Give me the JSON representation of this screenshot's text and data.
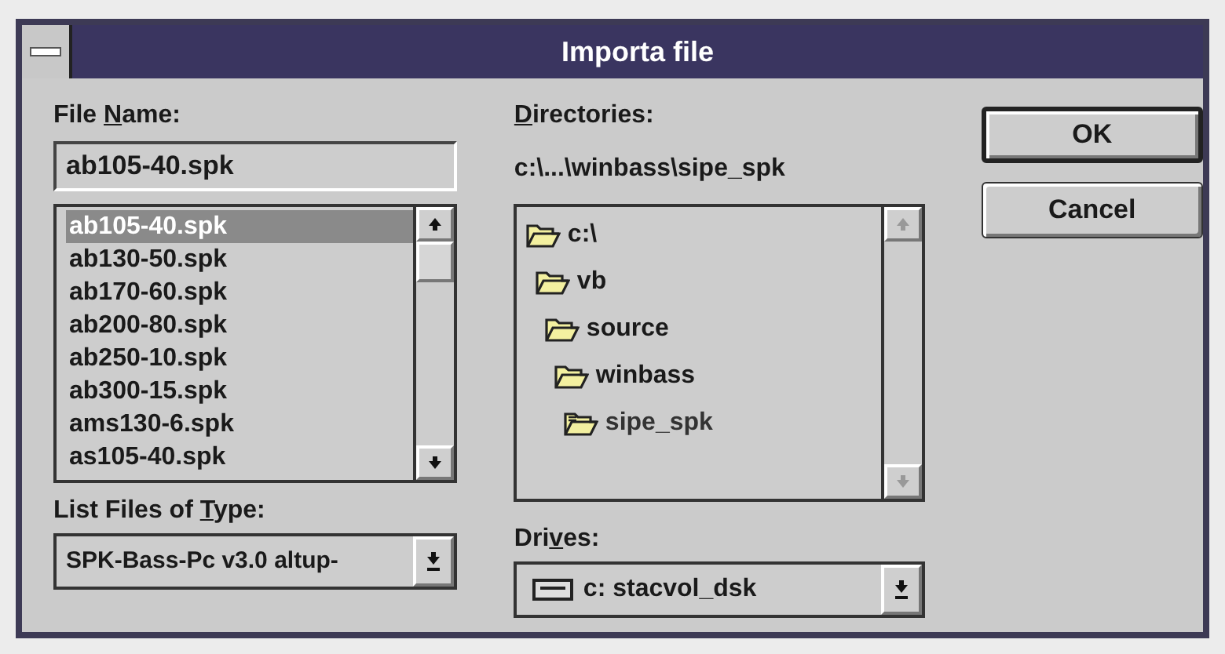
{
  "window": {
    "title": "Importa file"
  },
  "file_name": {
    "label": {
      "before": "File ",
      "key": "N",
      "after": "ame:"
    },
    "value": "ab105-40.spk"
  },
  "files": [
    {
      "name": "ab105-40.spk",
      "selected": true
    },
    {
      "name": "ab130-50.spk",
      "selected": false
    },
    {
      "name": "ab170-60.spk",
      "selected": false
    },
    {
      "name": "ab200-80.spk",
      "selected": false
    },
    {
      "name": "ab250-10.spk",
      "selected": false
    },
    {
      "name": "ab300-15.spk",
      "selected": false
    },
    {
      "name": "ams130-6.spk",
      "selected": false
    },
    {
      "name": "as105-40.spk",
      "selected": false
    }
  ],
  "file_type": {
    "label": {
      "before": "List Files of ",
      "key": "T",
      "after": "ype:"
    },
    "value": "SPK-Bass-Pc v3.0 altup-"
  },
  "directories": {
    "label": {
      "key": "D",
      "after": "irectories:"
    },
    "path": "c:\\...\\winbass\\sipe_spk",
    "tree": [
      {
        "name": "c:\\",
        "current": false,
        "children": [
          {
            "name": "vb",
            "current": false,
            "children": [
              {
                "name": "source",
                "current": false,
                "children": [
                  {
                    "name": "winbass",
                    "current": false,
                    "children": [
                      {
                        "name": "sipe_spk",
                        "current": true
                      }
                    ]
                  }
                ]
              }
            ]
          }
        ]
      }
    ]
  },
  "drives": {
    "label": {
      "before": "Dri",
      "key": "v",
      "after": "es:"
    },
    "value": "c: stacvol_dsk"
  },
  "buttons": [
    {
      "label": "OK",
      "default": true
    },
    {
      "label": "Cancel",
      "default": false
    }
  ]
}
